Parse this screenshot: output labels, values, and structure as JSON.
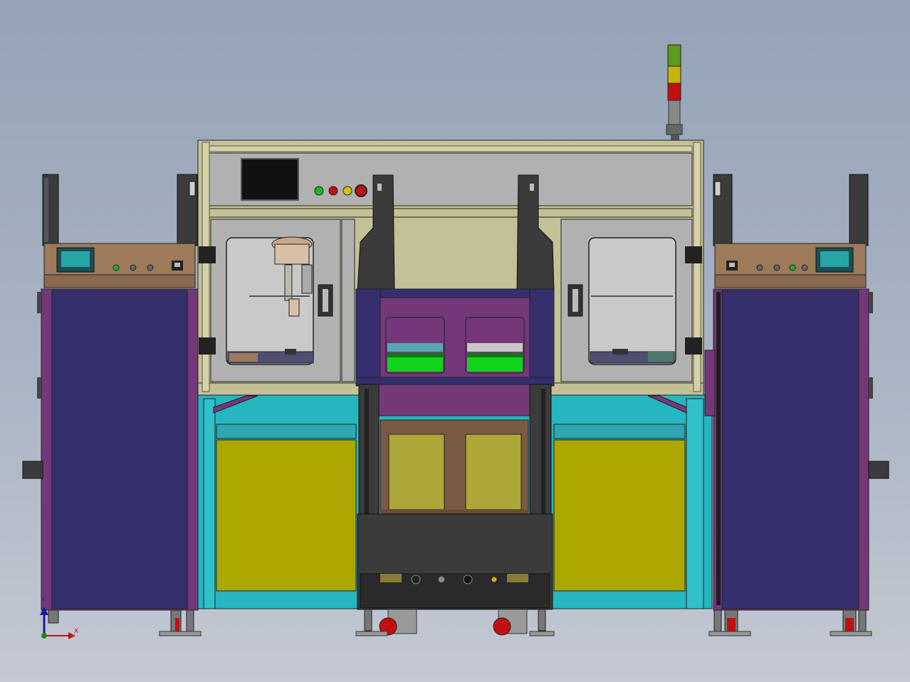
{
  "axes": {
    "x_label": "X",
    "y_label": "Y"
  },
  "colors": {
    "background_top": "#94a3b7",
    "cabinet_side": "#352f6d",
    "cabinet_trim": "#74377a",
    "frame_teal": "#25b6bf",
    "panel_yellow": "#aca700",
    "frame_aluminum": "#c4c196",
    "control_panel_gray": "#b1b1b1",
    "tan_panel": "#9c7a5a",
    "dark_column": "#3b3b3b",
    "green_band": "#12d31c",
    "stack_light_green": "#5b9a1a",
    "stack_light_yellow": "#c5b40c",
    "stack_light_red": "#c21010"
  },
  "indicators": {
    "main_panel": [
      "green",
      "red",
      "yellow",
      "red-emergency"
    ],
    "left_panel": [
      "green",
      "gray",
      "gray"
    ],
    "right_panel": [
      "gray",
      "gray",
      "green",
      "gray"
    ]
  },
  "icons": [
    "hmi-screen-icon",
    "stack-light-icon",
    "axis-triad-icon"
  ]
}
